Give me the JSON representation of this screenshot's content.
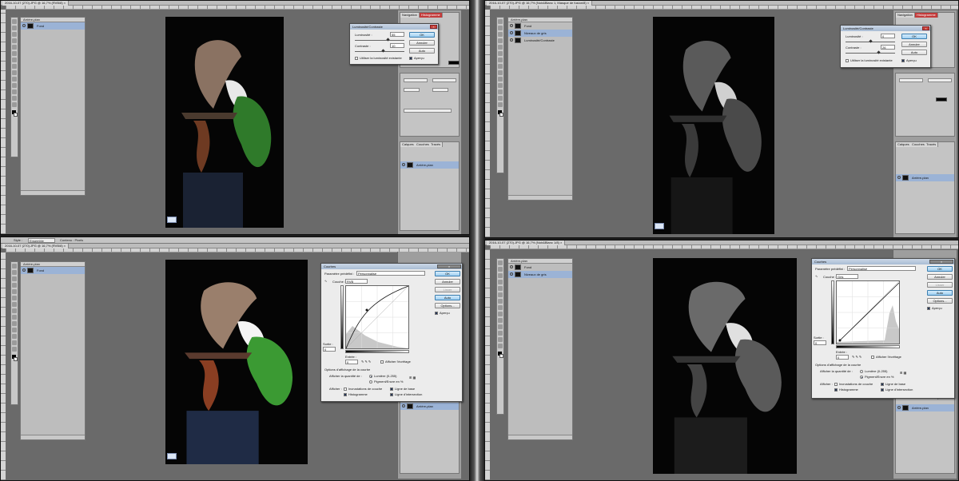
{
  "colors": {
    "workspace": "#6a6a6a",
    "dialog_bg": "#ececec",
    "primary_button": "#9fd0f2",
    "close_button": "#c8423c",
    "layer_selected": "#9bb3d6",
    "bonsai_foliage": "#2f7a2a",
    "bonsai_trunk": "#6e3a22",
    "pot_cloth": "#1a2233"
  },
  "icons": [
    "eye-icon",
    "lock-icon",
    "new-layer-icon",
    "trash-icon",
    "eyedropper-icon",
    "curve-tool-icon",
    "move-tool-icon"
  ],
  "quads": [
    {
      "doc_tab": "2016-10-07 (270).JPG @ 16,7% (RVB/8) ×",
      "layers": [
        {
          "name": "Fond",
          "active": true
        }
      ],
      "history_layer": "Arrière-plan",
      "dialog": {
        "title": "Luminosité/Contraste",
        "brightness_label": "Luminosité :",
        "brightness_value": "55",
        "contrast_label": "Contraste :",
        "contrast_value": "10",
        "legacy_label": "Utiliser la luminosité existante",
        "ok": "OK",
        "cancel": "Annuler",
        "auto": "Auto",
        "preview": "Aperçu"
      }
    },
    {
      "doc_tab": "2016-10-07 (270).JPG @ 16,7% (Noir&Blanc 1, Masque de fusion/8) ×",
      "layers": [
        {
          "name": "Fond",
          "active": false
        },
        {
          "name": "Niveaux de gris",
          "active": true
        },
        {
          "name": "Luminosité/Contraste",
          "active": false
        }
      ],
      "history_layer": "Arrière-plan",
      "dialog": {
        "title": "Luminosité/Contraste",
        "brightness_label": "Luminosité :",
        "brightness_value": "0",
        "contrast_label": "Contraste :",
        "contrast_value": "26",
        "legacy_label": "Utiliser la luminosité existante",
        "ok": "OK",
        "cancel": "Annuler",
        "auto": "Auto",
        "preview": "Aperçu"
      }
    },
    {
      "options_bar": {
        "style_label": "Style :",
        "style_value": "Ensemble",
        "content": "Contenu : Pixels"
      },
      "doc_tab": "2016-10-07 (270).JPG @ 16,7% (RVB/8) ×",
      "layers": [
        {
          "name": "Fond",
          "active": true
        }
      ],
      "history_layer": "Arrière-plan",
      "dialog": {
        "title": "Courbes",
        "preset_label": "Paramètre prédéfini :",
        "preset_value": "Personnalisé",
        "channel_label": "Couche :",
        "channel_value": "RVB",
        "output_label": "Sortie :",
        "output_value": "0",
        "input_label": "Entrée :",
        "input_value": "0",
        "show_clipping": "Afficher l'écrêtage",
        "display_options": "Options d'affichage de la courbe",
        "show_amount": "Afficher la quantité de :",
        "light": "Lumière (0-255)",
        "pigment": "Pigment/Encre en %",
        "show_label": "Afficher :",
        "channel_overlays": "Incrustations de couche",
        "baseline": "Ligne de base",
        "histogram": "Histogramme",
        "intersection": "Ligne d'intersection",
        "ok": "OK",
        "cancel": "Annuler",
        "smooth": "Lisser",
        "auto": "Auto",
        "options": "Options...",
        "preview": "Aperçu"
      }
    },
    {
      "doc_tab": "2016-10-07 (270).JPG @ 16,7% (Noir&Blanc 1/8) ×",
      "layers": [
        {
          "name": "Fond",
          "active": false
        },
        {
          "name": "Niveaux de gris",
          "active": true
        }
      ],
      "history_layer": "Arrière-plan",
      "dialog": {
        "title": "Courbes",
        "preset_label": "Paramètre prédéfini :",
        "preset_value": "Personnalisé",
        "channel_label": "Couche :",
        "channel_value": "Gris",
        "output_label": "Sortie :",
        "output_value": "0",
        "input_label": "Entrée :",
        "input_value": "0",
        "show_clipping": "Afficher l'écrêtage",
        "display_options": "Options d'affichage de la courbe",
        "show_amount": "Afficher la quantité de :",
        "light": "Lumière (0-255)",
        "pigment": "Pigment/Encre en %",
        "show_label": "Afficher :",
        "channel_overlays": "Incrustations de couche",
        "baseline": "Ligne de base",
        "histogram": "Histogramme",
        "intersection": "Ligne d'intersection",
        "ok": "OK",
        "cancel": "Annuler",
        "smooth": "Lisser",
        "auto": "Auto",
        "options": "Options...",
        "preview": "Aperçu"
      }
    }
  ],
  "dock": {
    "nav_tab": "Navigation",
    "hist_tab": "Histogramme",
    "layers_tab": "Calques",
    "channels_tab": "Couches",
    "paths_tab": "Tracés",
    "layer_name": "Arrière-plan"
  }
}
